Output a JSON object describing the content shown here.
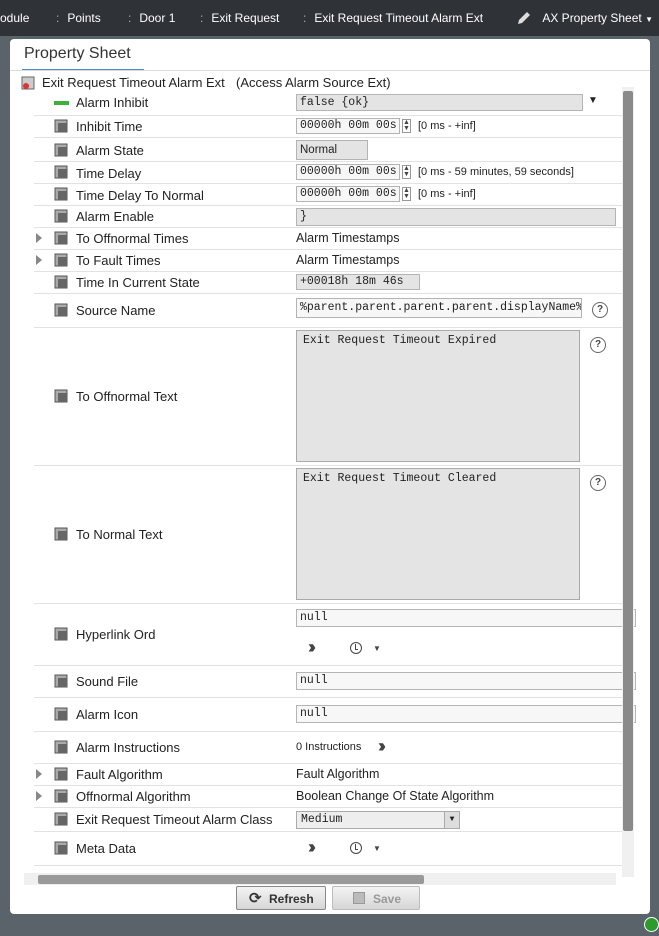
{
  "breadcrumb": [
    "odule",
    "Points",
    "Door 1",
    "Exit Request",
    "Exit Request Timeout Alarm Ext"
  ],
  "view_selector": "AX Property Sheet",
  "tab_title": "Property Sheet",
  "header": {
    "name": "Exit Request Timeout Alarm Ext",
    "type": "(Access Alarm Source Ext)"
  },
  "rows": {
    "alarm_inhibit": {
      "label": "Alarm Inhibit",
      "value": "false {ok}"
    },
    "inhibit_time": {
      "label": "Inhibit Time",
      "value": "00000h 00m 00s",
      "range": "[0 ms - +inf]"
    },
    "alarm_state": {
      "label": "Alarm State",
      "value": "Normal"
    },
    "time_delay": {
      "label": "Time Delay",
      "value": "00000h 00m 00s",
      "range": "[0 ms - 59 minutes, 59 seconds]"
    },
    "time_delay_to_normal": {
      "label": "Time Delay To Normal",
      "value": "00000h 00m 00s",
      "range": "[0 ms - +inf]"
    },
    "alarm_enable": {
      "label": "Alarm Enable",
      "value": "}"
    },
    "to_offnormal_times": {
      "label": "To Offnormal Times",
      "value": "Alarm Timestamps"
    },
    "to_fault_times": {
      "label": "To Fault Times",
      "value": "Alarm Timestamps"
    },
    "time_in_current_state": {
      "label": "Time In Current State",
      "value": "+00018h 18m 46s"
    },
    "source_name": {
      "label": "Source Name",
      "value": "%parent.parent.parent.parent.displayName%"
    },
    "to_offnormal_text": {
      "label": "To Offnormal Text",
      "value": "Exit Request Timeout Expired"
    },
    "to_normal_text": {
      "label": "To Normal Text",
      "value": "Exit Request Timeout Cleared"
    },
    "hyperlink_ord": {
      "label": "Hyperlink Ord",
      "value": "null"
    },
    "sound_file": {
      "label": "Sound File",
      "value": "null"
    },
    "alarm_icon": {
      "label": "Alarm Icon",
      "value": "null"
    },
    "alarm_instructions": {
      "label": "Alarm Instructions",
      "value": "0 Instructions"
    },
    "fault_algorithm": {
      "label": "Fault Algorithm",
      "value": "Fault Algorithm"
    },
    "offnormal_algorithm": {
      "label": "Offnormal Algorithm",
      "value": "Boolean Change Of State Algorithm"
    },
    "alarm_class": {
      "label": "Exit Request Timeout Alarm Class",
      "value": "Medium"
    },
    "meta_data": {
      "label": "Meta Data"
    }
  },
  "buttons": {
    "refresh": "Refresh",
    "save": "Save"
  },
  "icons": [
    "pencil-icon",
    "cube-icon",
    "help-icon",
    "chevron-double-right-icon",
    "clock-icon",
    "refresh-icon",
    "save-icon",
    "status-ok-icon"
  ],
  "colors": {
    "topbar": "#2f3237",
    "tab_accent": "#4a8bc2",
    "inhibit_green": "#3fae3f",
    "ok_green": "#2d9a2d"
  }
}
